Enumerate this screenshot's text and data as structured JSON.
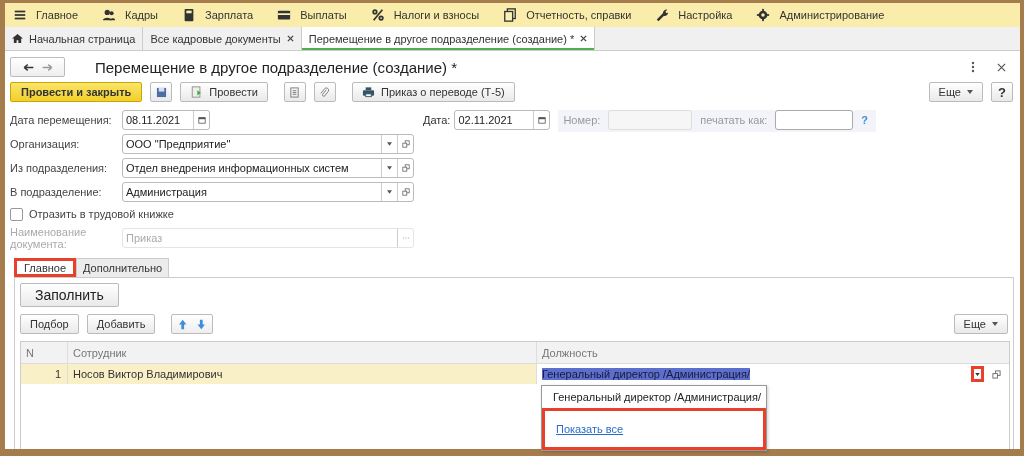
{
  "sections": [
    {
      "label": "Главное"
    },
    {
      "label": "Кадры"
    },
    {
      "label": "Зарплата"
    },
    {
      "label": "Выплаты"
    },
    {
      "label": "Налоги и взносы"
    },
    {
      "label": "Отчетность, справки"
    },
    {
      "label": "Настройка"
    },
    {
      "label": "Администрирование"
    }
  ],
  "open_tabs": [
    {
      "label": "Начальная страница",
      "kind": "home",
      "selected": false
    },
    {
      "label": "Все кадровые документы",
      "kind": "closable",
      "selected": false
    },
    {
      "label": "Перемещение в другое подразделение (создание) *",
      "kind": "closable",
      "selected": true
    }
  ],
  "form": {
    "title": "Перемещение в другое подразделение (создание) *",
    "toolbar": {
      "post_close": "Провести и закрыть",
      "post": "Провести",
      "print": "Приказ о переводе (Т-5)",
      "more": "Еще"
    },
    "fields": [
      {
        "kind": "date",
        "label": "Дата перемещения:",
        "value": "08.11.2021"
      },
      {
        "kind": "combo",
        "label": "Организация:",
        "value": "ООО \"Предприятие\""
      },
      {
        "kind": "combo",
        "label": "Из подразделения:",
        "value": "Отдел внедрения информационных систем"
      },
      {
        "kind": "combo",
        "label": "В подразделение:",
        "value": "Администрация"
      },
      {
        "kind": "checkbox",
        "label": "Отразить в трудовой книжке",
        "checked": false
      },
      {
        "kind": "disabled",
        "label": "Наименование документа:",
        "value": "Приказ"
      }
    ],
    "header_right": {
      "date_label": "Дата:",
      "date": "02.11.2021",
      "number_label": "Номер:",
      "print_as_label": "печатать как:",
      "help": "?"
    },
    "tabs": [
      {
        "label": "Главное",
        "selected": true,
        "annotated": true
      },
      {
        "label": "Дополнительно",
        "selected": false,
        "annotated": false
      }
    ],
    "fill_button": "Заполнить",
    "table_toolbar": {
      "pick": "Подбор",
      "add": "Добавить",
      "more": "Еще"
    },
    "table": {
      "columns": [
        "N",
        "Сотрудник",
        "Должность"
      ],
      "rows": [
        {
          "n": "1",
          "employee": "Носов Виктор Владимирович",
          "position": "Генеральный директор /Администрация/",
          "editing": true,
          "dropdown_annotated": true
        }
      ]
    },
    "dropdown": [
      {
        "kind": "option",
        "label": "Генеральный директор /Администрация/",
        "annotated": false
      },
      {
        "kind": "link",
        "label": "Показать все",
        "annotated": true
      }
    ]
  }
}
